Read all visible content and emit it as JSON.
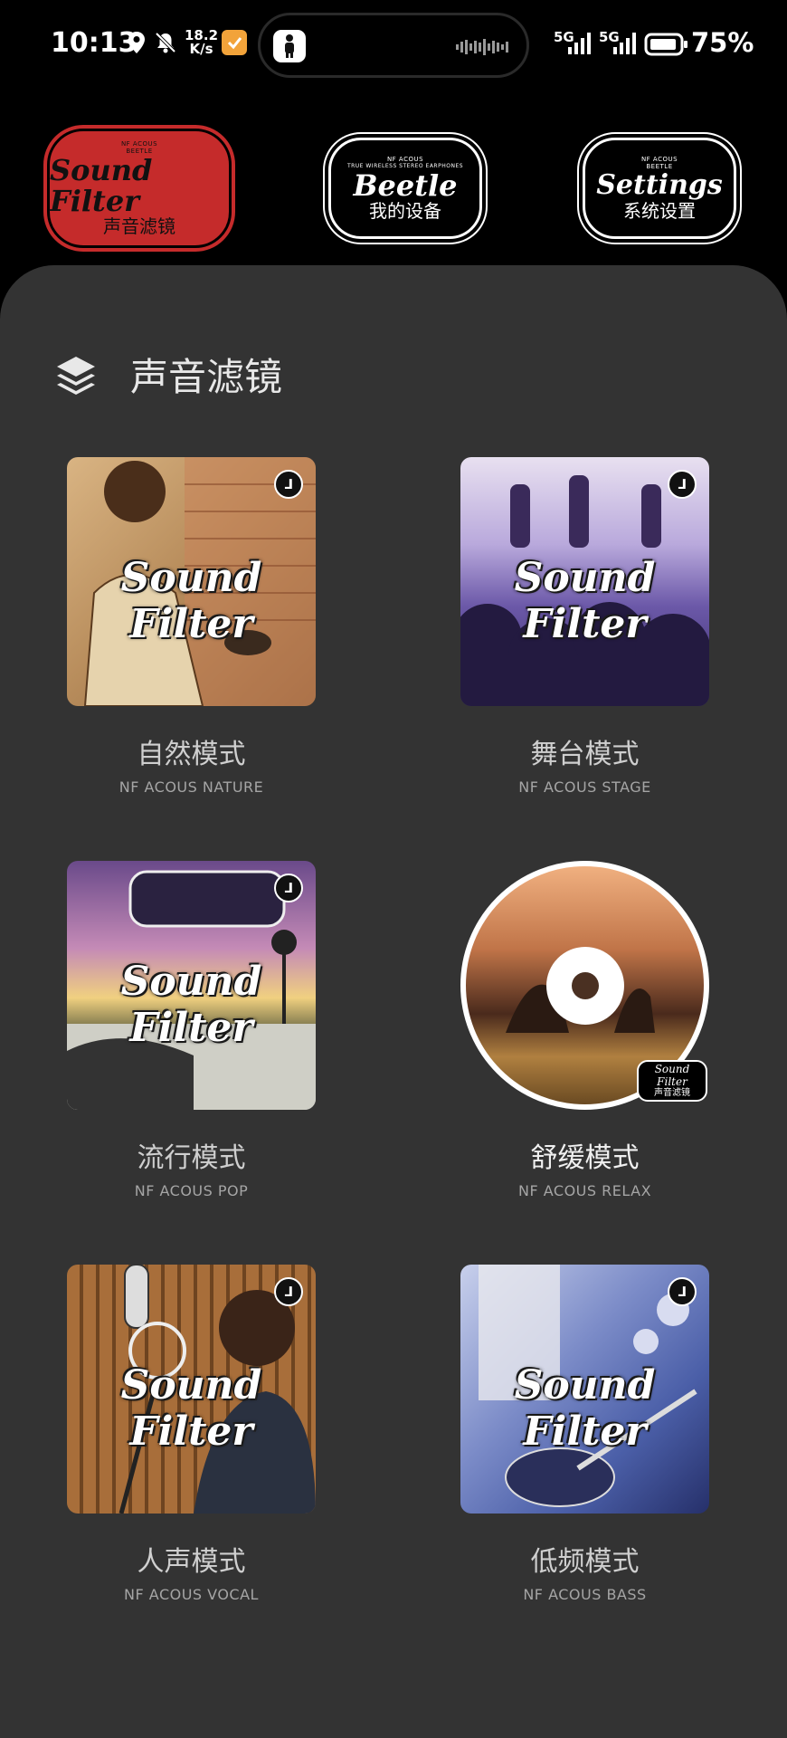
{
  "status_bar": {
    "time": "10:13",
    "speed_value": "18.2",
    "speed_unit": "K/s",
    "net1": "5G",
    "net2": "5G",
    "battery": "75%"
  },
  "top_nav": {
    "sound_filter": {
      "tiny1": "NF ACOUS",
      "tiny2": "BEETLE",
      "script": "Sound Filter",
      "cn": "声音滤镜"
    },
    "beetle": {
      "tiny1": "NF ACOUS",
      "tiny2": "TRUE WIRELESS STEREO EARPHONES",
      "script": "Beetle",
      "cn": "我的设备"
    },
    "settings": {
      "tiny1": "NF ACOUS",
      "tiny2": "BEETLE",
      "script": "Settings",
      "cn": "系统设置"
    }
  },
  "section": {
    "title": "声音滤镜",
    "icon": "layers-icon"
  },
  "cover_text": "Sound Filter",
  "disc_tag": {
    "script": "Sound Filter",
    "cn": "声音滤镜"
  },
  "modes": [
    {
      "title": "自然模式",
      "subtitle": "NF ACOUS NATURE",
      "bg": "#b98e5d"
    },
    {
      "title": "舞台模式",
      "subtitle": "NF ACOUS STAGE",
      "bg": "#6b58a8"
    },
    {
      "title": "流行模式",
      "subtitle": "NF ACOUS POP",
      "bg": "#8a6aa8"
    },
    {
      "title": "舒缓模式",
      "subtitle": "NF ACOUS RELAX",
      "bg": "#c07448"
    },
    {
      "title": "人声模式",
      "subtitle": "NF ACOUS VOCAL",
      "bg": "#8a5a32"
    },
    {
      "title": "低频模式",
      "subtitle": "NF ACOUS BASS",
      "bg": "#4b5fa8"
    }
  ],
  "colors": {
    "accent_red": "#c52b2b",
    "panel": "#333333",
    "background": "#000000"
  }
}
